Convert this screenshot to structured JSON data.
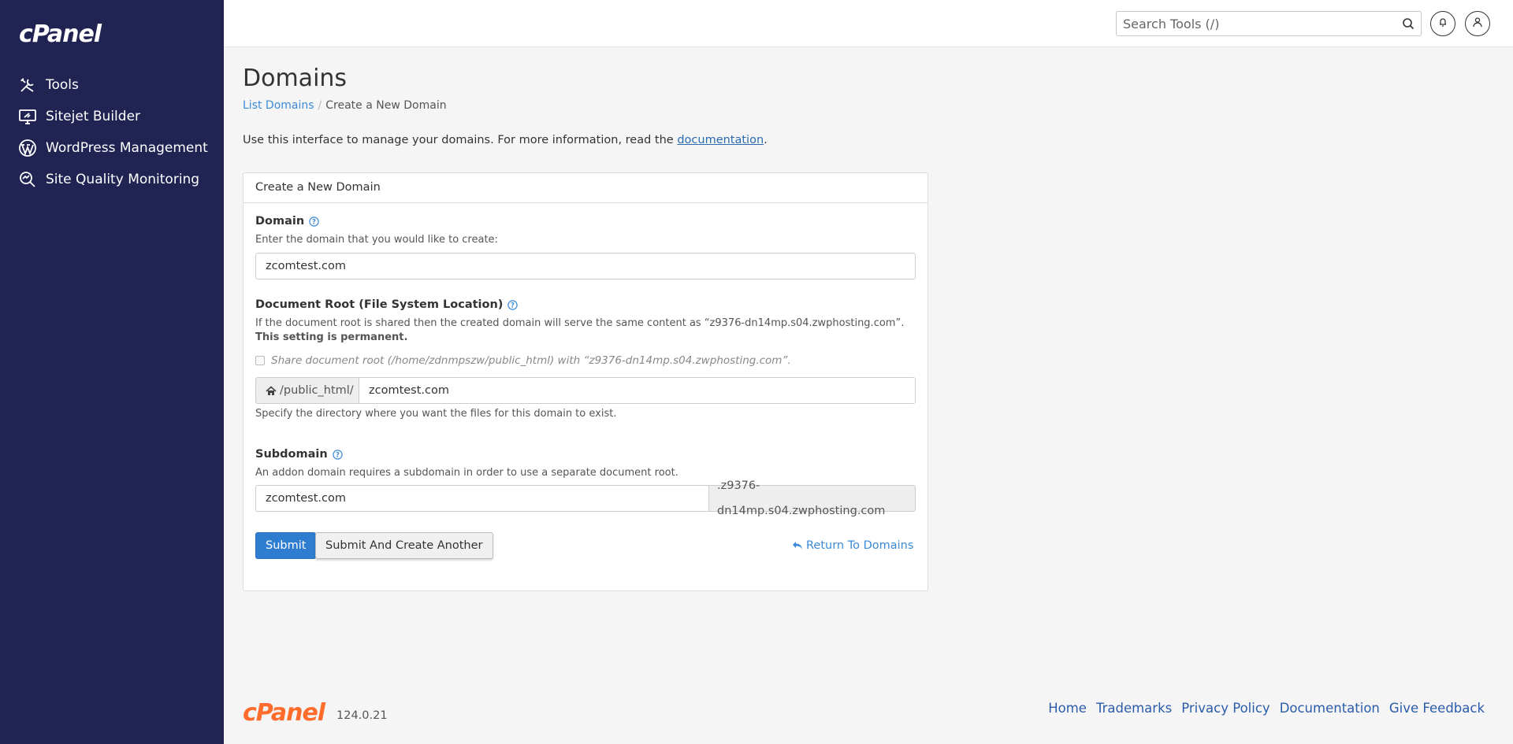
{
  "brand": {
    "logo_text": "cPanel",
    "version": "124.0.21"
  },
  "sidebar": {
    "items": [
      {
        "label": "Tools",
        "icon": "tools-icon"
      },
      {
        "label": "Sitejet Builder",
        "icon": "monitor-icon"
      },
      {
        "label": "WordPress Management",
        "icon": "wordpress-icon"
      },
      {
        "label": "Site Quality Monitoring",
        "icon": "magnifier-icon"
      }
    ]
  },
  "topbar": {
    "search_placeholder": "Search Tools (/)"
  },
  "page": {
    "title": "Domains",
    "breadcrumb": {
      "parent": "List Domains",
      "current": "Create a New Domain"
    },
    "intro_text": "Use this interface to manage your domains. For more information, read the ",
    "intro_link": "documentation",
    "intro_end": "."
  },
  "form": {
    "panel_title": "Create a New Domain",
    "domain": {
      "label": "Domain",
      "hint": "Enter the domain that you would like to create:",
      "value": "zcomtest.com"
    },
    "docroot": {
      "label": "Document Root (File System Location)",
      "hint_main": "If the document root is shared then the created domain will serve the same content as “z9376-dn14mp.s04.zwphosting.com”. ",
      "hint_bold": "This setting is permanent.",
      "share_label": "Share document root (/home/zdnmpszw/public_html) with “z9376-dn14mp.s04.zwphosting.com”.",
      "share_checked": false,
      "prefix": "/public_html/",
      "value": "zcomtest.com",
      "help": "Specify the directory where you want the files for this domain to exist."
    },
    "subdomain": {
      "label": "Subdomain",
      "hint": "An addon domain requires a subdomain in order to use a separate document root.",
      "value": "zcomtest.com",
      "suffix": ".z9376-dn14mp.s04.zwphosting.com"
    },
    "submit_label": "Submit",
    "submit_another_label": "Submit And Create Another",
    "return_label": "Return To Domains"
  },
  "footer": {
    "links": [
      "Home",
      "Trademarks",
      "Privacy Policy",
      "Documentation",
      "Give Feedback"
    ]
  },
  "colors": {
    "sidebar": "#212353",
    "primary": "#2f7dd1",
    "link": "#3c8ad8",
    "footer_logo": "#ff6c2c"
  }
}
